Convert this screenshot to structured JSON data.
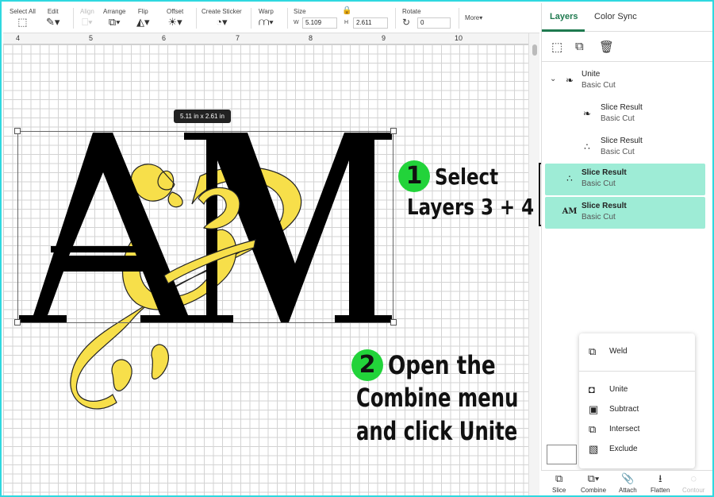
{
  "toolbar": {
    "select_all": "Select All",
    "edit": "Edit",
    "align": "Align",
    "arrange": "Arrange",
    "flip": "Flip",
    "offset": "Offset",
    "create_sticker": "Create Sticker",
    "warp": "Warp",
    "size": "Size",
    "size_w_label": "W",
    "size_w_value": "5.109",
    "size_h_label": "H",
    "size_h_value": "2.611",
    "rotate": "Rotate",
    "rotate_value": "0",
    "more": "More"
  },
  "ruler": {
    "marks": [
      "4",
      "5",
      "6",
      "7",
      "8",
      "9",
      "10"
    ]
  },
  "canvas": {
    "dimension_label": "5.11  in x 2.61  in",
    "artwork_text": "AM"
  },
  "annotations": {
    "step1_badge": "1",
    "step1_line1": "Select",
    "step1_line2": "Layers 3 + 4",
    "step2_badge": "2",
    "step2_line1": "Open the",
    "step2_line2": "Combine menu",
    "step2_line3": "and click Unite"
  },
  "panel": {
    "tabs": [
      {
        "label": "Layers",
        "active": true
      },
      {
        "label": "Color Sync",
        "active": false
      }
    ],
    "layers": [
      {
        "name": "Unite",
        "type": "Basic Cut",
        "selected": false
      },
      {
        "name": "Slice Result",
        "type": "Basic Cut",
        "selected": false
      },
      {
        "name": "Slice Result",
        "type": "Basic Cut",
        "selected": false
      },
      {
        "name": "Slice Result",
        "type": "Basic Cut",
        "selected": true
      },
      {
        "name": "Slice Result",
        "type": "Basic Cut",
        "selected": true
      }
    ],
    "layer4_thumb_text": "AM"
  },
  "combine_menu": {
    "items": [
      "Weld",
      "Unite",
      "Subtract",
      "Intersect",
      "Exclude"
    ]
  },
  "bottom_bar": {
    "items": [
      {
        "label": "Slice",
        "enabled": true
      },
      {
        "label": "Combine",
        "enabled": true
      },
      {
        "label": "Attach",
        "enabled": true
      },
      {
        "label": "Flatten",
        "enabled": true
      },
      {
        "label": "Contour",
        "enabled": false
      }
    ]
  },
  "colors": {
    "accent_green": "#1f7a4f",
    "selected_layer": "#9eecd6",
    "badge_green": "#22d33a",
    "artwork_yellow": "#f7df4a",
    "frame_border": "#2fd8e0"
  }
}
